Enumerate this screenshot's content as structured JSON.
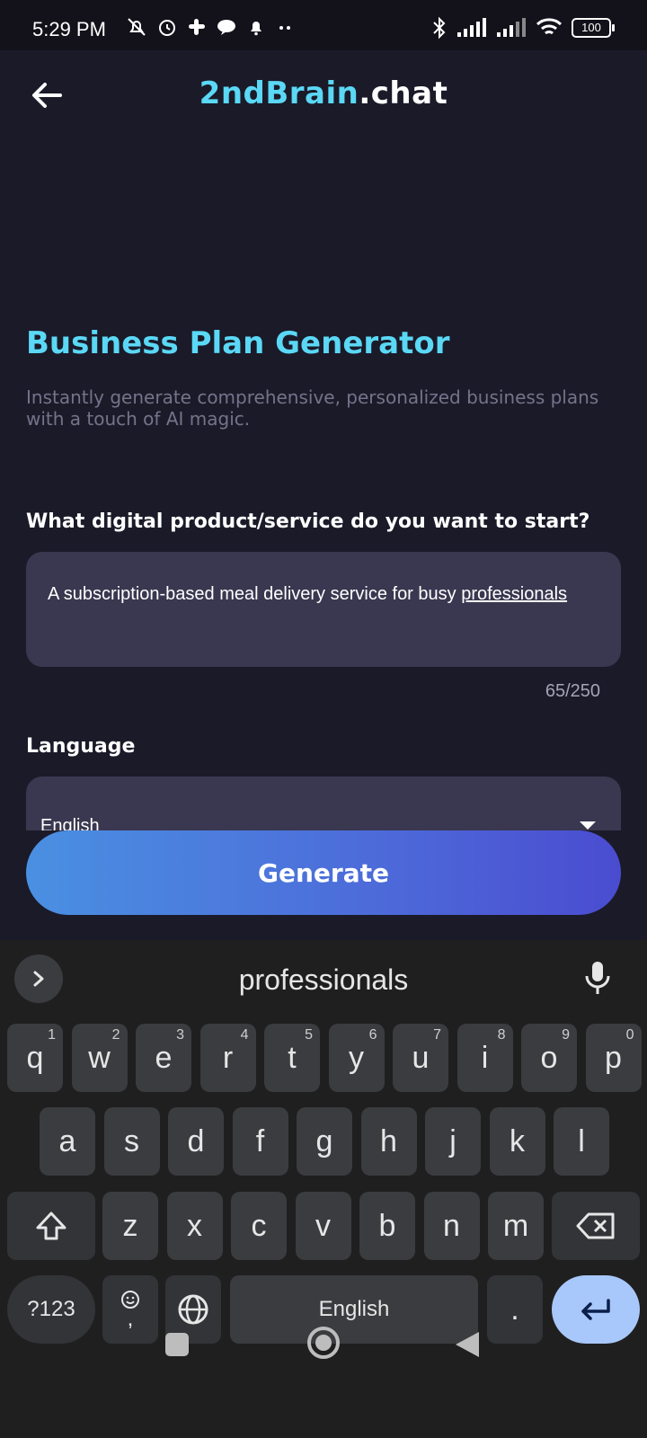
{
  "status_bar": {
    "time": "5:29 PM",
    "battery": "100",
    "left_icons": [
      "mute-bell-icon",
      "alarm-icon",
      "slack-icon",
      "chat-icon",
      "bell-icon",
      "more-dots-icon"
    ],
    "right_icons": [
      "bluetooth-icon",
      "signal-icon",
      "signal-icon",
      "wifi-icon",
      "battery-icon"
    ]
  },
  "header": {
    "brand_accent": "2ndBrain",
    "brand_rest": ".chat",
    "back_icon": "arrow-left-icon"
  },
  "page": {
    "title": "Business Plan Generator",
    "subtitle": "Instantly generate comprehensive, personalized business plans with a touch of AI magic.",
    "question_label": "What digital product/service do you want to start?",
    "product_text_plain": "A subscription-based meal delivery service for busy ",
    "product_text_underlined": "professionals",
    "char_counter": "65/250",
    "language_label": "Language",
    "language_value": "English",
    "generate_label": "Generate"
  },
  "keyboard": {
    "suggestion": "professionals",
    "row1": [
      {
        "k": "q",
        "h": "1"
      },
      {
        "k": "w",
        "h": "2"
      },
      {
        "k": "e",
        "h": "3"
      },
      {
        "k": "r",
        "h": "4"
      },
      {
        "k": "t",
        "h": "5"
      },
      {
        "k": "y",
        "h": "6"
      },
      {
        "k": "u",
        "h": "7"
      },
      {
        "k": "i",
        "h": "8"
      },
      {
        "k": "o",
        "h": "9"
      },
      {
        "k": "p",
        "h": "0"
      }
    ],
    "row2": [
      "a",
      "s",
      "d",
      "f",
      "g",
      "h",
      "j",
      "k",
      "l"
    ],
    "row3": [
      "z",
      "x",
      "c",
      "v",
      "b",
      "n",
      "m"
    ],
    "symbols_label": "?123",
    "comma_label": ",",
    "space_label": "English",
    "period_label": "."
  },
  "colors": {
    "accent": "#5ad8f5",
    "background": "#1b1a29",
    "input_bg": "#3a3750",
    "enter_key": "#a8c7fa"
  }
}
